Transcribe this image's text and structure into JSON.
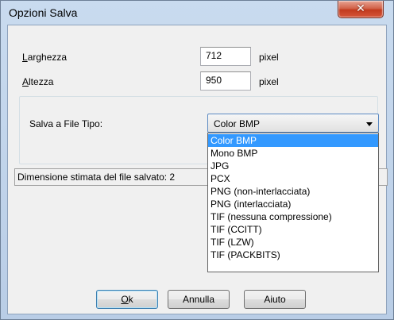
{
  "window": {
    "title": "Opzioni Salva",
    "close_glyph": "✕"
  },
  "form": {
    "width": {
      "label_key": "L",
      "label_rest": "arghezza",
      "value": "712",
      "unit": "pixel"
    },
    "height": {
      "label_key": "A",
      "label_rest": "ltezza",
      "value": "950",
      "unit": "pixel"
    }
  },
  "file_type": {
    "label": "Salva a File Tipo:",
    "selected": "Color BMP",
    "options": [
      "Color BMP",
      "Mono BMP",
      "JPG",
      "PCX",
      "PNG (non-interlacciata)",
      "PNG (interlacciata)",
      "TIF (nessuna compressione)",
      "TIF (CCITT)",
      "TIF (LZW)",
      "TIF (PACKBITS)"
    ],
    "highlighted_index": 0
  },
  "status": {
    "text": "Dimensione stimata del file salvato: 2"
  },
  "buttons": {
    "ok_key": "O",
    "ok_rest": "k",
    "cancel": "Annulla",
    "help": "Aiuto"
  },
  "icons": {
    "close": "close-icon",
    "dropdown": "chevron-down-icon"
  }
}
